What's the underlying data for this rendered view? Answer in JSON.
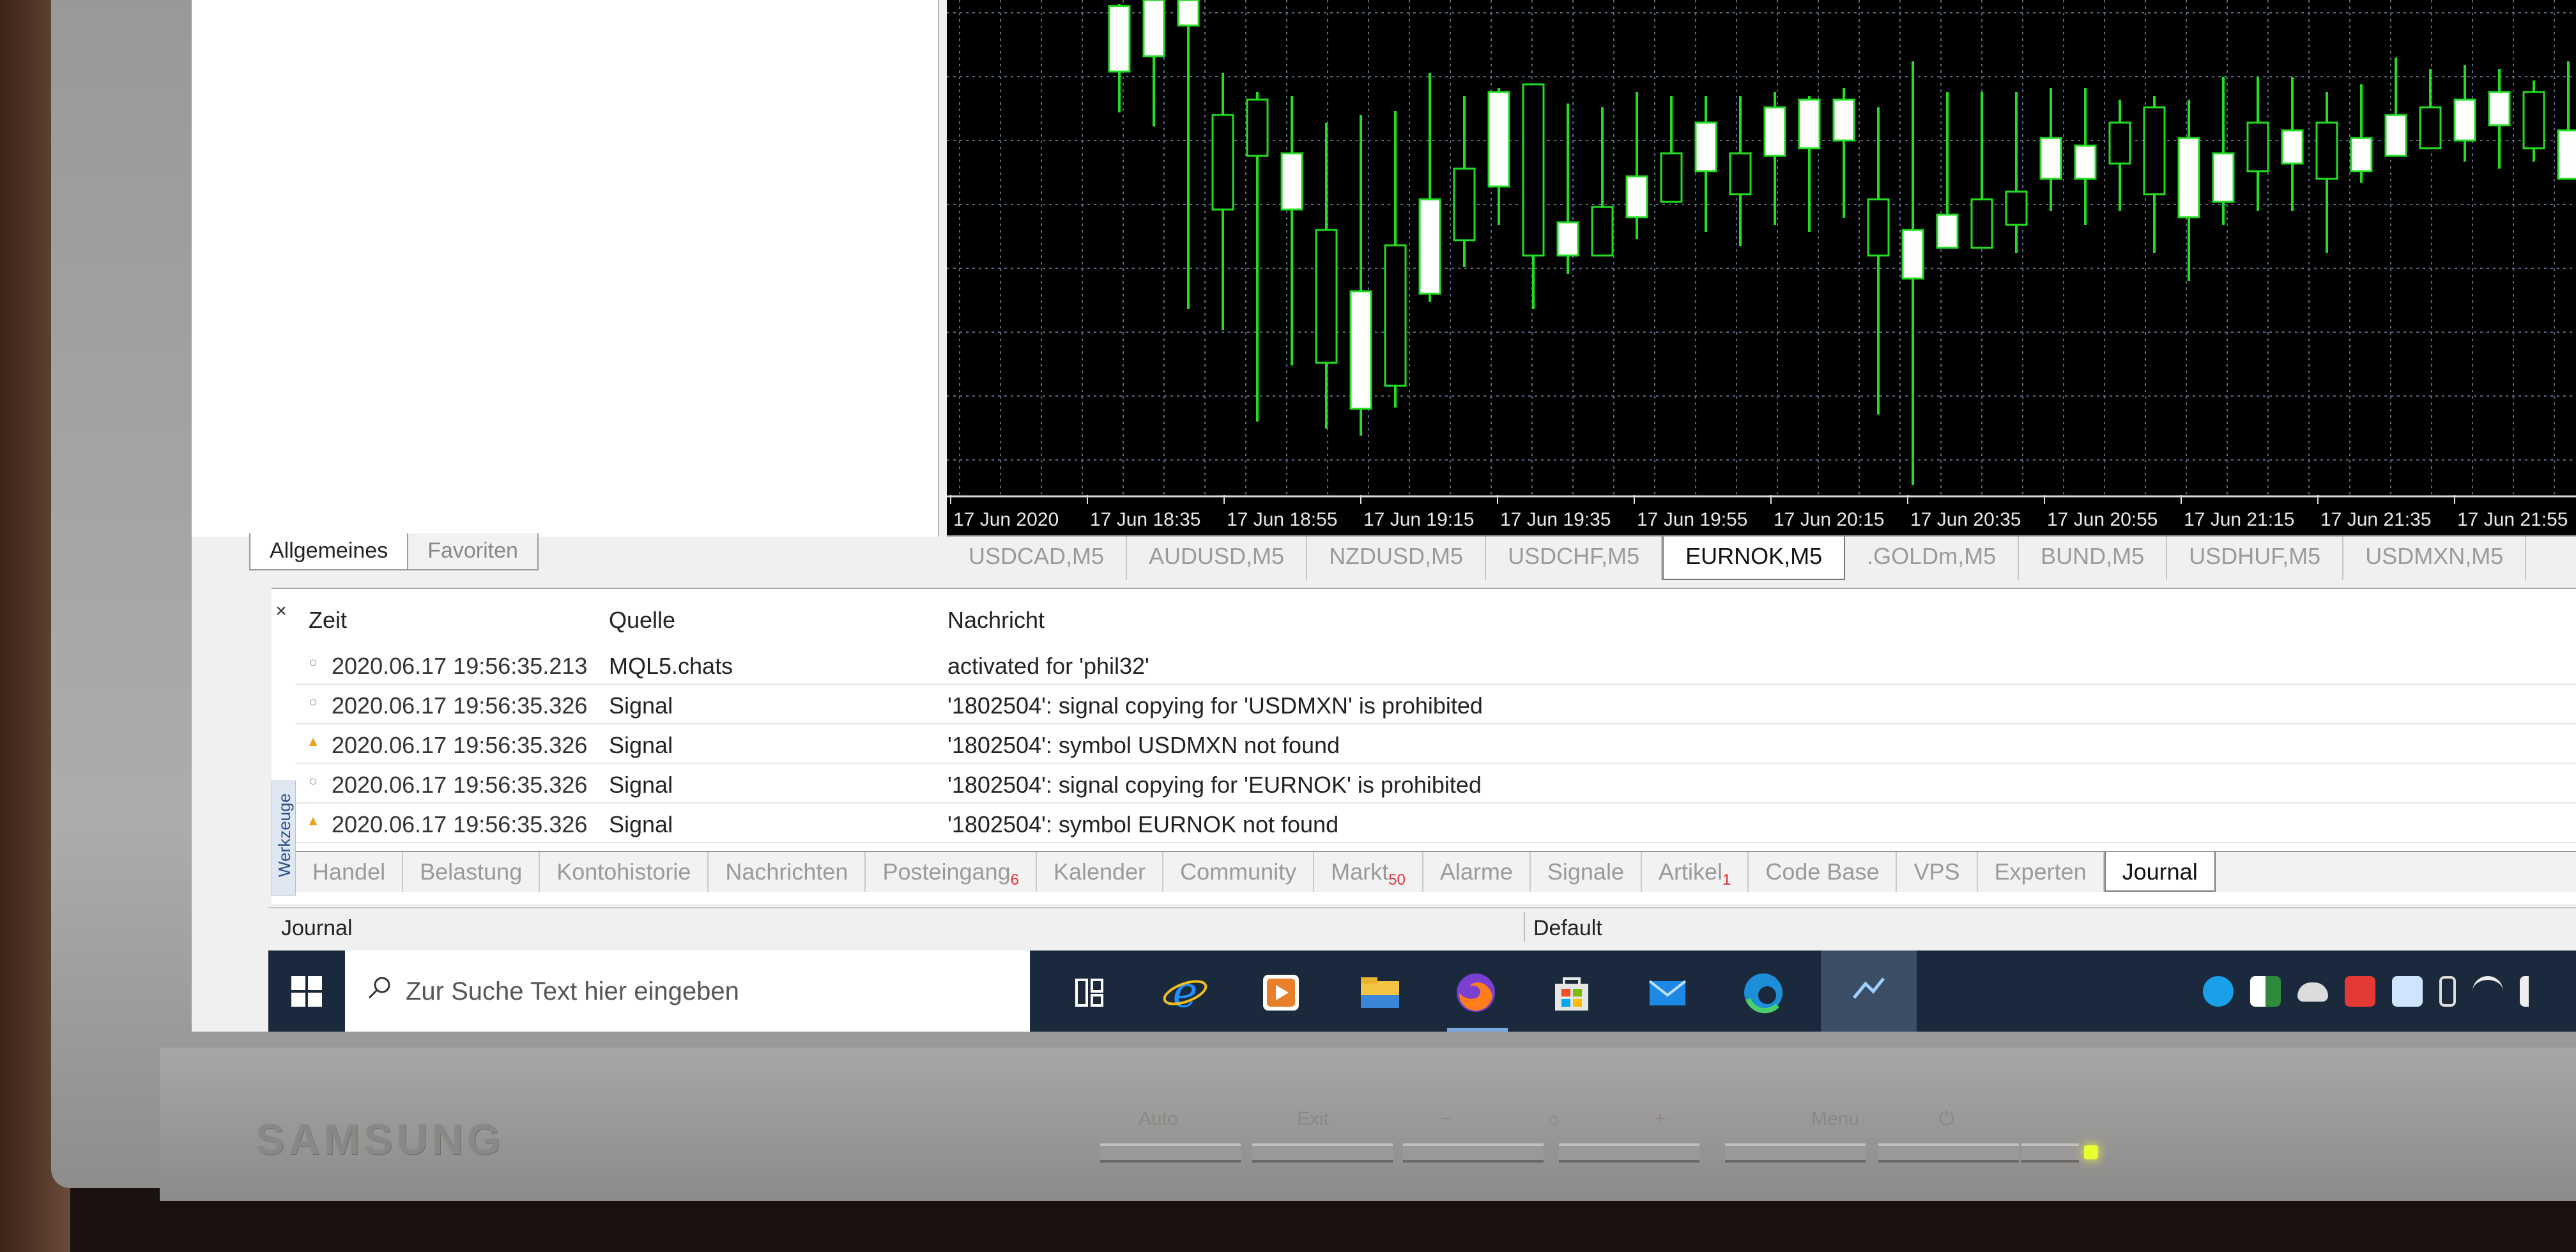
{
  "monitor": {
    "brand": "SAMSUNG",
    "buttons": [
      "Auto",
      "Exit",
      "−",
      "☼",
      "+",
      "Menu",
      "⏻"
    ]
  },
  "navigator": {
    "tabs": [
      "Allgemeines",
      "Favoriten"
    ]
  },
  "chart": {
    "time_labels": [
      "17 Jun 2020",
      "17 Jun 18:35",
      "17 Jun 18:55",
      "17 Jun 19:15",
      "17 Jun 19:35",
      "17 Jun 19:55",
      "17 Jun 20:15",
      "17 Jun 20:35",
      "17 Jun 20:55",
      "17 Jun 21:15",
      "17 Jun 21:35",
      "17 Jun 21:55"
    ],
    "colors": {
      "background": "#000000",
      "bull_wick": "#22dd22",
      "body": "#ffffff",
      "grid": "#5a6a80"
    }
  },
  "chart_tabs": [
    "USDCAD,M5",
    "AUDUSD,M5",
    "NZDUSD,M5",
    "USDCHF,M5",
    "EURNOK,M5",
    ".GOLDm,M5",
    "BUND,M5",
    "USDHUF,M5",
    "USDMXN,M5"
  ],
  "chart_tab_active": "EURNOK,M5",
  "toolbox": {
    "side_label": "Werkzeuge",
    "close": "×",
    "columns": {
      "time": "Zeit",
      "source": "Quelle",
      "message": "Nachricht"
    },
    "rows": [
      {
        "type": "info",
        "time": "2020.06.17 19:56:35.213",
        "source": "MQL5.chats",
        "message": "activated for 'phil32'"
      },
      {
        "type": "info",
        "time": "2020.06.17 19:56:35.326",
        "source": "Signal",
        "message": "'1802504': signal copying for 'USDMXN' is prohibited"
      },
      {
        "type": "warn",
        "time": "2020.06.17 19:56:35.326",
        "source": "Signal",
        "message": "'1802504': symbol USDMXN not found"
      },
      {
        "type": "info",
        "time": "2020.06.17 19:56:35.326",
        "source": "Signal",
        "message": "'1802504': signal copying for 'EURNOK' is prohibited"
      },
      {
        "type": "warn",
        "time": "2020.06.17 19:56:35.326",
        "source": "Signal",
        "message": "'1802504': symbol EURNOK not found"
      }
    ],
    "tabs": [
      {
        "label": "Handel"
      },
      {
        "label": "Belastung"
      },
      {
        "label": "Kontohistorie"
      },
      {
        "label": "Nachrichten"
      },
      {
        "label": "Posteingang",
        "badge": "6"
      },
      {
        "label": "Kalender"
      },
      {
        "label": "Community"
      },
      {
        "label": "Markt",
        "badge": "50"
      },
      {
        "label": "Alarme"
      },
      {
        "label": "Signale"
      },
      {
        "label": "Artikel",
        "badge": "1"
      },
      {
        "label": "Code Base"
      },
      {
        "label": "VPS"
      },
      {
        "label": "Experten"
      },
      {
        "label": "Journal"
      }
    ],
    "active_tab": "Journal"
  },
  "statusbar": {
    "left": "Journal",
    "profile": "Default"
  },
  "taskbar": {
    "search_placeholder": "Zur Suche Text hier eingeben",
    "apps": [
      "task-view",
      "internet-explorer",
      "media-player",
      "file-explorer",
      "firefox",
      "microsoft-store",
      "mail",
      "edge",
      "metatrader"
    ],
    "tray": [
      "skype",
      "defender",
      "onedrive",
      "antivirus",
      "dropbox",
      "usb",
      "wifi",
      "volume"
    ]
  }
}
